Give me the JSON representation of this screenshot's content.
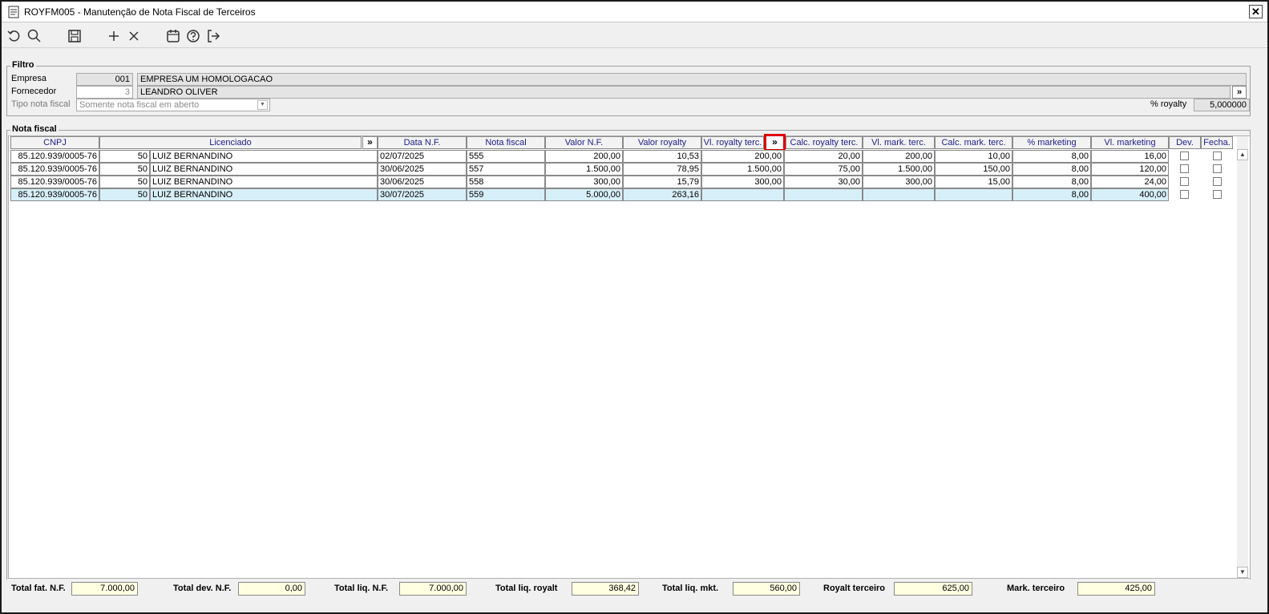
{
  "window": {
    "title": "ROYFM005 - Manutenção de Nota Fiscal de Terceiros",
    "close": "✕"
  },
  "toolbar": {
    "icons": [
      "undo-icon",
      "search-icon",
      "save-icon",
      "add-icon",
      "delete-icon",
      "calendar-icon",
      "help-icon",
      "exit-icon"
    ]
  },
  "filtro": {
    "legend": "Filtro",
    "empresa_label": "Empresa",
    "empresa_code": "001",
    "empresa_name": "EMPRESA UM HOMOLOGACAO",
    "fornecedor_label": "Fornecedor",
    "fornecedor_code": "3",
    "fornecedor_name": "LEANDRO OLIVER",
    "tipo_label": "Tipo nota fiscal",
    "tipo_value": "Somente nota fiscal em aberto",
    "royalty_label": "% royalty",
    "royalty_value": "5,000000",
    "expand": "»"
  },
  "nota": {
    "legend": "Nota fiscal",
    "expand": "»",
    "headers": {
      "cnpj": "CNPJ",
      "licenciado": "Licenciado",
      "data": "Data N.F.",
      "nota": "Nota fiscal",
      "valor_nf": "Valor N.F.",
      "valor_royalty": "Valor royalty",
      "vl_royalty_terc": "Vl. royalty terc.",
      "calc_royalty_terc": "Calc. royalty terc.",
      "vl_mark_terc": "Vl. mark. terc.",
      "calc_mark_terc": "Calc. mark. terc.",
      "pct_marketing": "% marketing",
      "vl_marketing": "Vl. marketing",
      "dev": "Dev.",
      "fecha": "Fecha."
    },
    "rows": [
      {
        "cnpj": "85.120.939/0005-76",
        "code": "50",
        "name": "LUIZ BERNANDINO",
        "data": "02/07/2025",
        "nota": "555",
        "valor_nf": "200,00",
        "valor_royalty": "10,53",
        "vl_royalty_terc": "200,00",
        "calc_royalty_terc": "20,00",
        "vl_mark_terc": "200,00",
        "calc_mark_terc": "10,00",
        "pct_marketing": "8,00",
        "vl_marketing": "16,00"
      },
      {
        "cnpj": "85.120.939/0005-76",
        "code": "50",
        "name": "LUIZ BERNANDINO",
        "data": "30/06/2025",
        "nota": "557",
        "valor_nf": "1.500,00",
        "valor_royalty": "78,95",
        "vl_royalty_terc": "1.500,00",
        "calc_royalty_terc": "75,00",
        "vl_mark_terc": "1.500,00",
        "calc_mark_terc": "150,00",
        "pct_marketing": "8,00",
        "vl_marketing": "120,00"
      },
      {
        "cnpj": "85.120.939/0005-76",
        "code": "50",
        "name": "LUIZ BERNANDINO",
        "data": "30/06/2025",
        "nota": "558",
        "valor_nf": "300,00",
        "valor_royalty": "15,79",
        "vl_royalty_terc": "300,00",
        "calc_royalty_terc": "30,00",
        "vl_mark_terc": "300,00",
        "calc_mark_terc": "15,00",
        "pct_marketing": "8,00",
        "vl_marketing": "24,00"
      },
      {
        "cnpj": "85.120.939/0005-76",
        "code": "50",
        "name": "LUIZ BERNANDINO",
        "data": "30/07/2025",
        "nota": "559",
        "valor_nf": "5.000,00",
        "valor_royalty": "263,16",
        "vl_royalty_terc": "",
        "calc_royalty_terc": "",
        "vl_mark_terc": "",
        "calc_mark_terc": "",
        "pct_marketing": "8,00",
        "vl_marketing": "400,00"
      }
    ]
  },
  "totals": {
    "fat_label": "Total fat. N.F.",
    "fat_value": "7.000,00",
    "dev_label": "Total dev. N.F.",
    "dev_value": "0,00",
    "liq_label": "Total liq. N.F.",
    "liq_value": "7.000,00",
    "royalty_label": "Total liq. royalt",
    "royalty_value": "368,42",
    "mkt_label": "Total liq. mkt.",
    "mkt_value": "560,00",
    "royalt_terc_label": "Royalt terceiro",
    "royalt_terc_value": "625,00",
    "mark_terc_label": "Mark. terceiro",
    "mark_terc_value": "425,00"
  },
  "colors": {
    "header_text": "#1c1c8c",
    "selected_row": "#d7eff9",
    "totals_bg": "#ffffe1",
    "highlight": "#e00000"
  }
}
